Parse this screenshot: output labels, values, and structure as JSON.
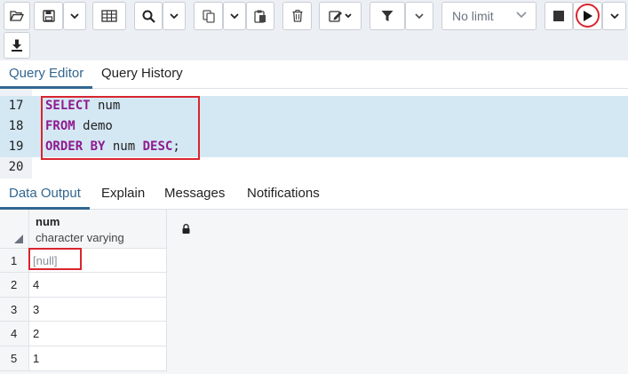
{
  "toolbar": {
    "limit_label": "No limit",
    "icons": [
      "folder-open-icon",
      "save-icon",
      "chevron-down-icon",
      "grid-icon",
      "search-icon",
      "copy-icon",
      "paste-icon",
      "trash-icon",
      "edit-icon",
      "filter-icon",
      "stop-icon",
      "play-icon",
      "download-icon"
    ],
    "accent": "#326690",
    "highlight_red": "#d9252e"
  },
  "editor_tabs": [
    {
      "label": "Query Editor",
      "active": true
    },
    {
      "label": "Query History",
      "active": false
    }
  ],
  "editor": {
    "lines": [
      {
        "num": "17",
        "text": "SELECT num"
      },
      {
        "num": "18",
        "text": "FROM demo"
      },
      {
        "num": "19",
        "text": "ORDER BY num DESC;"
      },
      {
        "num": "20",
        "text": ""
      }
    ],
    "keywords": {
      "l17": {
        "kw": "SELECT",
        "rest": " num"
      },
      "l18": {
        "kw": "FROM",
        "rest": " demo"
      },
      "l19": {
        "kw1": "ORDER BY",
        "mid": " num ",
        "kw2": "DESC",
        "end": ";"
      }
    }
  },
  "result_tabs": [
    {
      "label": "Data Output",
      "active": true
    },
    {
      "label": "Explain",
      "active": false
    },
    {
      "label": "Messages",
      "active": false
    },
    {
      "label": "Notifications",
      "active": false
    }
  ],
  "grid": {
    "column": {
      "name": "num",
      "type": "character varying"
    },
    "rows": [
      {
        "row": "1",
        "value": "[null]"
      },
      {
        "row": "2",
        "value": "4"
      },
      {
        "row": "3",
        "value": "3"
      },
      {
        "row": "4",
        "value": "2"
      },
      {
        "row": "5",
        "value": "1"
      }
    ]
  }
}
